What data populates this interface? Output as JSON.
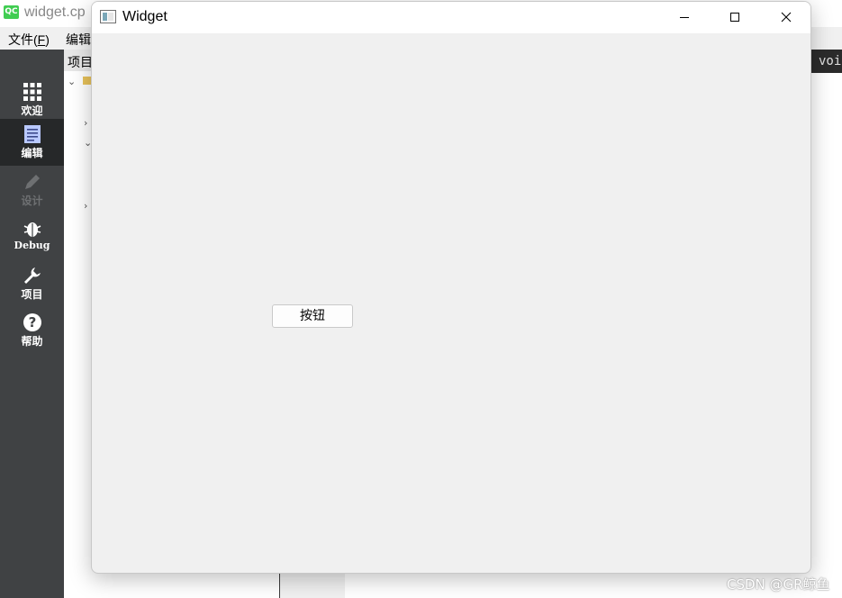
{
  "background_app": {
    "title": "widget.cp",
    "logo_text": "QC",
    "menu": [
      {
        "label": "文件(",
        "mnemonic": "F",
        "suffix": ")"
      },
      {
        "label": "编辑",
        "mnemonic": "",
        "suffix": ""
      }
    ],
    "modes": [
      {
        "label": "欢迎",
        "icon": "grid-icon"
      },
      {
        "label": "编辑",
        "icon": "document-icon"
      },
      {
        "label": "设计",
        "icon": "pencil-icon"
      },
      {
        "label": "Debug",
        "icon": "bug-icon"
      },
      {
        "label": "项目",
        "icon": "wrench-icon"
      },
      {
        "label": "帮助",
        "icon": "help-icon"
      }
    ],
    "projects_header": "项目",
    "code_snippet": "voi"
  },
  "window": {
    "title": "Widget",
    "buttons": {
      "minimize": "minimize-icon",
      "maximize": "maximize-icon",
      "close": "close-icon"
    }
  },
  "content": {
    "push_button_label": "按钮"
  },
  "watermark": "CSDN @GR鲸鱼",
  "colors": {
    "modebar": "#404244",
    "modebar_active": "#262829",
    "window_bg": "#f0f0f0",
    "qt_green": "#41cd52"
  }
}
